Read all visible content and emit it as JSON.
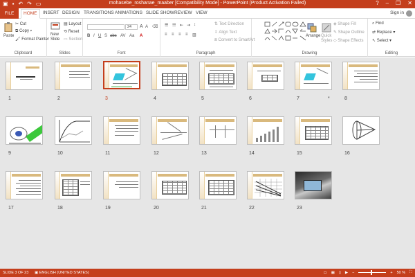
{
  "titlebar": {
    "title": "mohasebe_roshanae_maaber [Compatibility Mode] - PowerPoint (Product Activation Failed)",
    "help": "?",
    "minimize": "–",
    "restore": "❐",
    "close": "✕"
  },
  "tabs": {
    "file": "FILE",
    "items": [
      "HOME",
      "INSERT",
      "DESIGN",
      "TRANSITIONS",
      "ANIMATIONS",
      "SLIDE SHOW",
      "REVIEW",
      "VIEW"
    ],
    "active": "HOME",
    "sign_in": "Sign in"
  },
  "ribbon": {
    "clipboard": {
      "paste": "Paste",
      "cut": "Cut",
      "copy": "Copy",
      "format_painter": "Format Painter",
      "label": "Clipboard"
    },
    "slides": {
      "new_slide": "New",
      "new_slide2": "Slide",
      "layout": "Layout",
      "reset": "Reset",
      "section": "Section",
      "label": "Slides"
    },
    "font": {
      "size": "24",
      "grow": "A",
      "shrink": "A",
      "label": "Font"
    },
    "paragraph": {
      "text_direction": "Text Direction",
      "align_text": "Align Text",
      "convert": "Convert to SmartArt",
      "label": "Paragraph"
    },
    "drawing": {
      "arrange": "Arrange",
      "quick_styles": "Quick",
      "quick_styles2": "Styles",
      "shape_fill": "Shape Fill",
      "shape_outline": "Shape Outline",
      "shape_effects": "Shape Effects",
      "label": "Drawing"
    },
    "editing": {
      "find": "Find",
      "replace": "Replace",
      "select": "Select",
      "label": "Editing"
    }
  },
  "slides": [
    {
      "n": "1",
      "kind": "title"
    },
    {
      "n": "2",
      "kind": "text"
    },
    {
      "n": "3",
      "kind": "diagram-cyan"
    },
    {
      "n": "4",
      "kind": "table"
    },
    {
      "n": "5",
      "kind": "table"
    },
    {
      "n": "6",
      "kind": "table-small"
    },
    {
      "n": "7",
      "kind": "diagram-cyan",
      "star": "*"
    },
    {
      "n": "8",
      "kind": "text-right"
    },
    {
      "n": "9",
      "kind": "green-diagram"
    },
    {
      "n": "10",
      "kind": "chart"
    },
    {
      "n": "11",
      "kind": "text"
    },
    {
      "n": "12",
      "kind": "diagram"
    },
    {
      "n": "13",
      "kind": "diagram"
    },
    {
      "n": "14",
      "kind": "bars"
    },
    {
      "n": "15",
      "kind": "table-small"
    },
    {
      "n": "16",
      "kind": "cone"
    },
    {
      "n": "17",
      "kind": "text-right"
    },
    {
      "n": "18",
      "kind": "table"
    },
    {
      "n": "19",
      "kind": "text"
    },
    {
      "n": "20",
      "kind": "table"
    },
    {
      "n": "21",
      "kind": "table"
    },
    {
      "n": "22",
      "kind": "grid"
    },
    {
      "n": "23",
      "kind": "photo"
    }
  ],
  "selected_slide": "3",
  "status": {
    "slide_info": "SLIDE 3 OF 23",
    "language": "ENGLISH (UNITED STATES)",
    "zoom": "50 %"
  }
}
